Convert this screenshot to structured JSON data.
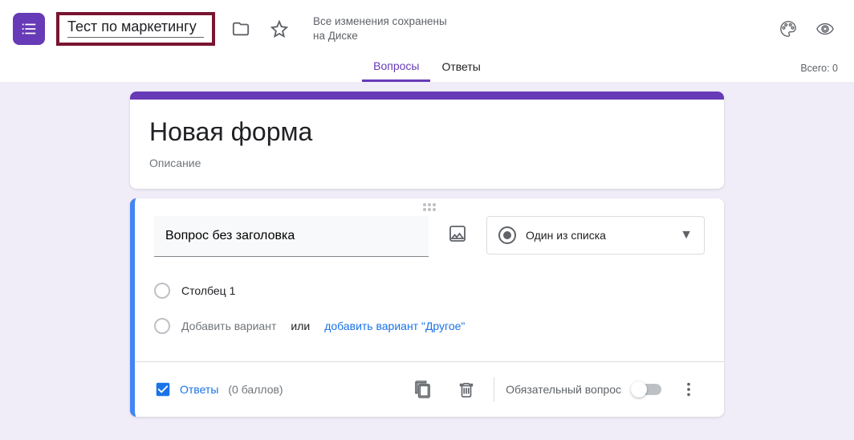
{
  "header": {
    "title_value": "Тест по маркетингу",
    "save_status": "Все изменения сохранены на Диске"
  },
  "tabs": {
    "questions": "Вопросы",
    "responses": "Ответы",
    "total_label": "Всего: 0"
  },
  "form": {
    "title": "Новая форма",
    "description": "Описание"
  },
  "question": {
    "title": "Вопрос без заголовка",
    "type_label": "Один из списка",
    "option1": "Столбец 1",
    "add_option": "Добавить вариант",
    "or_text": "или",
    "add_other": "добавить вариант \"Другое\""
  },
  "footer": {
    "answers": "Ответы",
    "points": "(0 баллов)",
    "required": "Обязательный вопрос"
  }
}
